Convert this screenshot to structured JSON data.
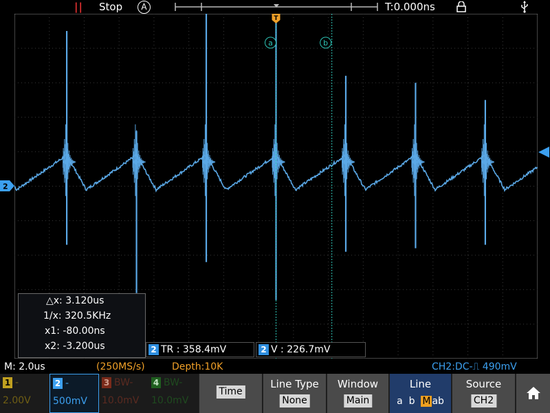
{
  "status_bar": {
    "run_state": "Stop",
    "trigger_mode": "A",
    "time_position": "T:0.000ns"
  },
  "markers": {
    "trigger": "T",
    "cursor_a": "a",
    "cursor_b": "b",
    "channel2": "2"
  },
  "cursor_box": {
    "delta_x": "△x: 3.120us",
    "inv_delta_x": "1/x: 320.5KHz",
    "x1": "x1: -80.00ns",
    "x2": "x2: -3.200us"
  },
  "measurements": [
    {
      "channel": "2",
      "text": "TR : 358.4mV"
    },
    {
      "channel": "2",
      "text": "V : 226.7mV"
    }
  ],
  "horizontal": {
    "timebase": "M: 2.0us",
    "sample_rate": "(250MS/s)",
    "depth": "Depth:10K",
    "trigger_info": "CH2:DC-⎍ 490mV"
  },
  "channels": [
    {
      "num": "1",
      "coupling": "-",
      "scale": "2.00V"
    },
    {
      "num": "2",
      "coupling": "-",
      "scale": "500mV"
    },
    {
      "num": "3",
      "coupling": "BW-",
      "scale": "10.0mV"
    },
    {
      "num": "4",
      "coupling": "BW-",
      "scale": "10.0mV"
    }
  ],
  "menu": {
    "time_value": "Time",
    "line_type_title": "Line Type",
    "line_type_value": "None",
    "window_title": "Window",
    "window_value": "Main",
    "line_title": "Line",
    "line_opt_a": "a",
    "line_opt_b": "b",
    "line_opt_m": "M",
    "line_opt_ab": "ab",
    "source_title": "Source",
    "source_value": "CH2"
  },
  "icons": {
    "run": "pause-icon",
    "auto": "auto-trigger-icon",
    "lock": "lock-icon",
    "usb": "usb-icon",
    "home": "home-icon"
  },
  "colors": {
    "trace": "#5aa8e6",
    "cursor": "#2ec4b6",
    "trigger": "#f0a028",
    "ch1": "#c0a020",
    "ch2": "#3ca0f0",
    "ch3": "#7a2a1a",
    "ch4": "#1f5f1f",
    "menu_active": "#213c6a"
  },
  "chart_data": {
    "type": "line",
    "grid": true,
    "grid_divisions": {
      "x": 15,
      "y": 10
    },
    "series": [
      {
        "baseline_div": 0,
        "spike_positions_div": [
          1.5,
          3.5,
          5.5,
          7.5,
          9.5,
          11.5,
          13.5
        ],
        "spike_max_div": [
          4.5,
          1.6,
          5.0,
          5.0,
          3.2,
          3.0,
          2.5
        ],
        "spike_min_div": [
          -1.7,
          -3.1,
          -2.2,
          -3.3,
          -1.9,
          -1.8,
          -1.7
        ],
        "valley_div": -0.1,
        "shoulder_div": 0.9
      }
    ]
  }
}
